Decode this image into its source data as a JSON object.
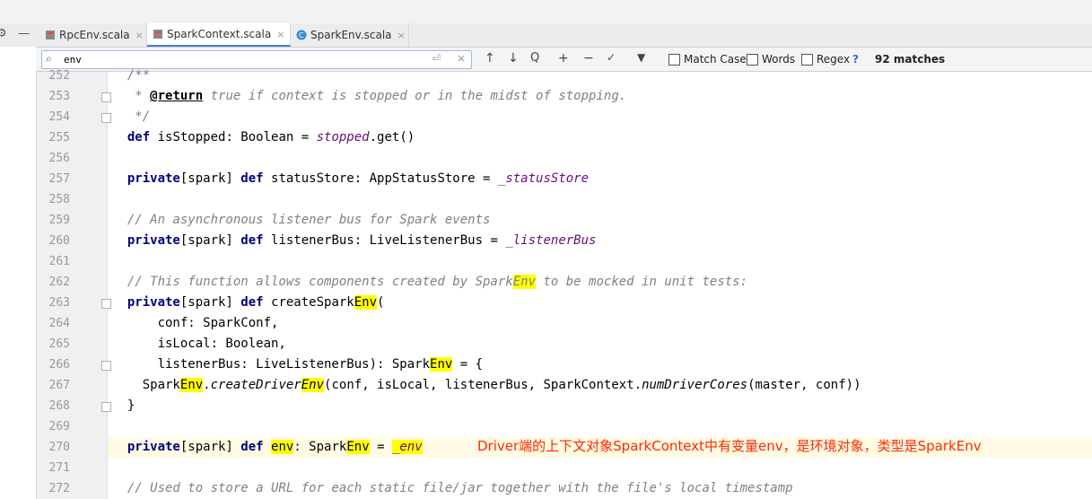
{
  "leftctl": {
    "gear": "⚙",
    "minus": "—"
  },
  "tabs": [
    {
      "label": "RpcEnv.scala",
      "close": "×",
      "icon": "scala-file-icon"
    },
    {
      "label": "SparkContext.scala",
      "close": "×",
      "icon": "scala-file-icon"
    },
    {
      "label": "SparkEnv.scala",
      "close": "×",
      "icon": "scala-class-icon"
    }
  ],
  "find": {
    "query": "env",
    "search_icon": "⌕",
    "replace_icon": "⏎",
    "clear_icon": "×",
    "prev": "↑",
    "next": "↓",
    "find_in_selection": "Q",
    "add_occurrence": "+",
    "remove_occurrence": "−",
    "select_all": "✓",
    "filter": "▼",
    "match_case": "Match Case",
    "words": "Words",
    "regex": "Regex",
    "help": "?",
    "matches": "92 matches"
  },
  "lines": [
    {
      "n": "252",
      "parts": [
        {
          "t": "  /**",
          "c": "cm"
        }
      ]
    },
    {
      "n": "253",
      "parts": [
        {
          "t": "   * ",
          "c": "cm"
        },
        {
          "t": "@return",
          "c": "tag"
        },
        {
          "t": " true if context is stopped or in the midst of stopping.",
          "c": "cm"
        }
      ]
    },
    {
      "n": "254",
      "parts": [
        {
          "t": "   */",
          "c": "cm"
        }
      ]
    },
    {
      "n": "255",
      "parts": [
        {
          "t": "  def",
          "c": "kw"
        },
        {
          "t": " isStopped: Boolean = ",
          "c": ""
        },
        {
          "t": "stopped",
          "c": "it"
        },
        {
          "t": ".get()",
          "c": ""
        }
      ]
    },
    {
      "n": "256",
      "parts": []
    },
    {
      "n": "257",
      "parts": [
        {
          "t": "  private",
          "c": "kw"
        },
        {
          "t": "[spark] ",
          "c": ""
        },
        {
          "t": "def",
          "c": "kw"
        },
        {
          "t": " statusStore: AppStatusStore = ",
          "c": ""
        },
        {
          "t": "_statusStore",
          "c": "it"
        }
      ]
    },
    {
      "n": "258",
      "parts": []
    },
    {
      "n": "259",
      "parts": [
        {
          "t": "  // An asynchronous listener bus for Spark events",
          "c": "cm"
        }
      ]
    },
    {
      "n": "260",
      "parts": [
        {
          "t": "  private",
          "c": "kw"
        },
        {
          "t": "[spark] ",
          "c": ""
        },
        {
          "t": "def",
          "c": "kw"
        },
        {
          "t": " listenerBus: LiveListenerBus = ",
          "c": ""
        },
        {
          "t": "_listenerBus",
          "c": "it"
        }
      ]
    },
    {
      "n": "261",
      "parts": []
    },
    {
      "n": "262",
      "parts": [
        {
          "t": "  // This function allows components created by Spark",
          "c": "cm"
        },
        {
          "t": "Env",
          "c": "cm hl"
        },
        {
          "t": " to be mocked in unit tests:",
          "c": "cm"
        }
      ]
    },
    {
      "n": "263",
      "parts": [
        {
          "t": "  private",
          "c": "kw"
        },
        {
          "t": "[spark] ",
          "c": ""
        },
        {
          "t": "def",
          "c": "kw"
        },
        {
          "t": " createSpark",
          "c": ""
        },
        {
          "t": "Env",
          "c": "hl"
        },
        {
          "t": "(",
          "c": ""
        }
      ]
    },
    {
      "n": "264",
      "parts": [
        {
          "t": "      conf: SparkConf,",
          "c": ""
        }
      ]
    },
    {
      "n": "265",
      "parts": [
        {
          "t": "      isLocal: Boolean,",
          "c": ""
        }
      ]
    },
    {
      "n": "266",
      "parts": [
        {
          "t": "      listenerBus: LiveListenerBus): Spark",
          "c": ""
        },
        {
          "t": "Env",
          "c": "hl"
        },
        {
          "t": " = {",
          "c": ""
        }
      ]
    },
    {
      "n": "267",
      "parts": [
        {
          "t": "    Spark",
          "c": ""
        },
        {
          "t": "Env",
          "c": "hl"
        },
        {
          "t": ".",
          "c": ""
        },
        {
          "t": "createDriver",
          "c": "fn"
        },
        {
          "t": "Env",
          "c": "fn hl"
        },
        {
          "t": "(conf, isLocal, listenerBus, SparkContext.",
          "c": ""
        },
        {
          "t": "numDriverCores",
          "c": "fn"
        },
        {
          "t": "(master, conf))",
          "c": ""
        }
      ]
    },
    {
      "n": "268",
      "parts": [
        {
          "t": "  }",
          "c": ""
        }
      ]
    },
    {
      "n": "269",
      "parts": []
    },
    {
      "n": "270",
      "parts": [
        {
          "t": "  private",
          "c": "kw"
        },
        {
          "t": "[spark] ",
          "c": ""
        },
        {
          "t": "def",
          "c": "kw"
        },
        {
          "t": " ",
          "c": ""
        },
        {
          "t": "|",
          "c": "caret"
        },
        {
          "t": "env",
          "c": "hl"
        },
        {
          "t": ": Spark",
          "c": ""
        },
        {
          "t": "Env",
          "c": "hl"
        },
        {
          "t": " = ",
          "c": ""
        },
        {
          "t": "_env",
          "c": "it hl"
        }
      ]
    },
    {
      "n": "271",
      "parts": []
    },
    {
      "n": "272",
      "parts": [
        {
          "t": "  // Used to store a URL for each static file/jar together with the file's local timestamp",
          "c": "cm"
        }
      ]
    }
  ],
  "annotation": "Driver端的上下文对象SparkContext中有变量env，是环境对象，类型是SparkEnv",
  "colors": {
    "keyword": "#000080",
    "comment": "#808080",
    "field": "#660e7a",
    "highlight": "#ffff00",
    "annotation": "#ff2a00"
  }
}
